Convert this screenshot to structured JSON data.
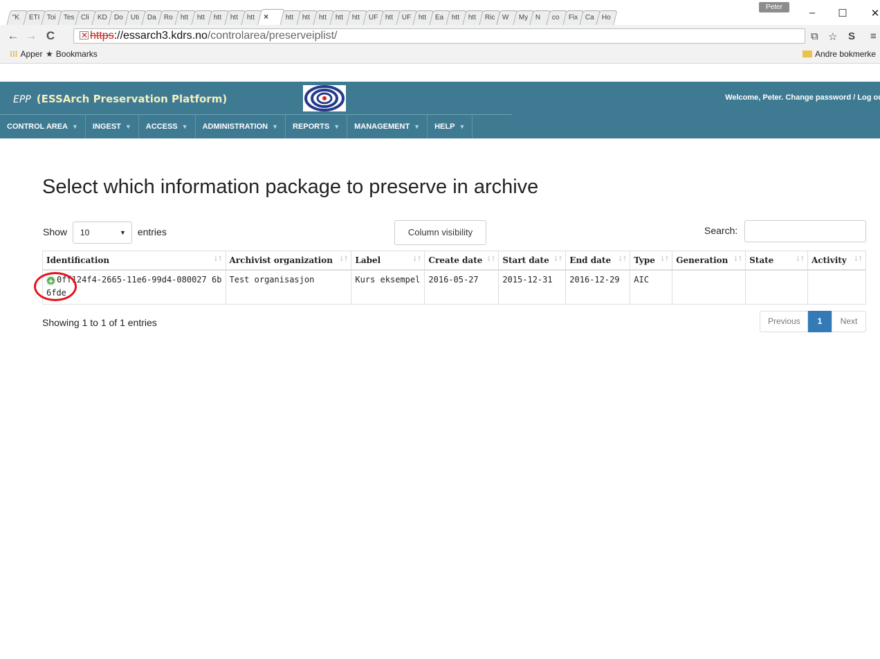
{
  "browser": {
    "tabs": [
      "\"K",
      "ETI",
      "Toi",
      "Tes",
      "Cli",
      "KD",
      "Do",
      "Uti",
      "Da",
      "Ro",
      "htt",
      "htt",
      "htt",
      "htt",
      "htt",
      "×",
      "htt",
      "htt",
      "htt",
      "htt",
      "htt",
      "UF",
      "htt",
      "UF",
      "htt",
      "Ea",
      "htt",
      "htt",
      "Ric",
      "W",
      "My",
      "N",
      "co",
      "Fix",
      "Ca",
      "Ho"
    ],
    "profile": "Peter",
    "url": {
      "scheme": "https",
      "host": "://essarch3.kdrs.no",
      "path": "/controlarea/preserveiplist/"
    },
    "bookmarks": {
      "apps": "Apper",
      "bookmarks": "Bookmarks",
      "other": "Andre bokmerke"
    }
  },
  "header": {
    "abbr": "EPP",
    "title": "(ESSArch Preservation Platform)",
    "welcome": "Welcome, Peter. Change password / Log ou"
  },
  "menu": [
    {
      "label": "CONTROL AREA"
    },
    {
      "label": "INGEST"
    },
    {
      "label": "ACCESS"
    },
    {
      "label": "ADMINISTRATION"
    },
    {
      "label": "REPORTS"
    },
    {
      "label": "MANAGEMENT"
    },
    {
      "label": "HELP"
    }
  ],
  "page": {
    "title": "Select which information package to preserve in archive",
    "show_label": "Show",
    "entries_value": "10",
    "entries_label": "entries",
    "column_visibility": "Column visibility",
    "search_label": "Search:",
    "info": "Showing 1 to 1 of 1 entries",
    "pager": {
      "previous": "Previous",
      "current": "1",
      "next": "Next"
    }
  },
  "table": {
    "columns": [
      "Identification",
      "Archivist organization",
      "Label",
      "Create date",
      "Start date",
      "End date",
      "Type",
      "Generation",
      "State",
      "Activity"
    ],
    "rows": [
      [
        "0ff124f4-2665-11e6-99d4-080027 6b6fde",
        "Test organisasjon",
        "Kurs eksempel",
        "2016-05-27",
        "2015-12-31",
        "2016-12-29",
        "AIC",
        "",
        "",
        ""
      ]
    ]
  },
  "colors": {
    "header_bg": "#3f7a93",
    "pager_active": "#337ab7",
    "annotation": "#e4121b"
  }
}
